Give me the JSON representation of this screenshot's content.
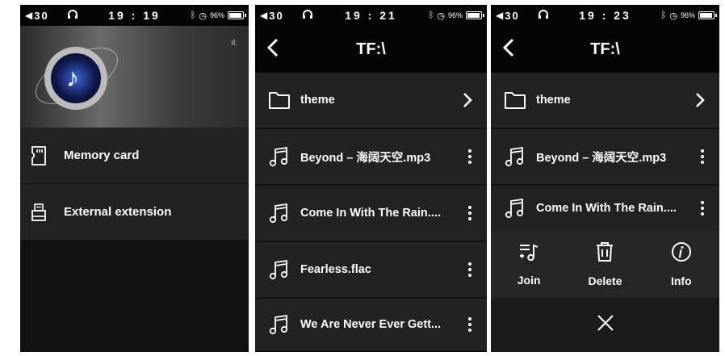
{
  "colors": {
    "panel": "#222222",
    "bar": "#050505",
    "text": "#ffffff"
  },
  "status": [
    {
      "volume": "30",
      "time": "19 : 19",
      "battery": "96%",
      "battery_level": 0.96
    },
    {
      "volume": "30",
      "time": "19 : 21",
      "battery": "96%",
      "battery_level": 0.96
    },
    {
      "volume": "30",
      "time": "19 : 23",
      "battery": "96%",
      "battery_level": 0.96
    }
  ],
  "home": {
    "items": [
      {
        "label": "Memory card",
        "icon": "sd-card-icon"
      },
      {
        "label": "External extension",
        "icon": "usb-drive-icon"
      }
    ]
  },
  "browser": {
    "title": "TF:\\",
    "items": [
      {
        "label": "theme",
        "icon": "folder-icon",
        "trail": "chevron-right-icon"
      },
      {
        "label": "Beyond – 海阔天空.mp3",
        "icon": "music-note-icon",
        "trail": "more-vertical-icon"
      },
      {
        "label": "Come In With The Rain....",
        "icon": "music-note-icon",
        "trail": "more-vertical-icon"
      },
      {
        "label": "Fearless.flac",
        "icon": "music-note-icon",
        "trail": "more-vertical-icon"
      },
      {
        "label": "We Are Never Ever Gett...",
        "icon": "music-note-icon",
        "trail": "more-vertical-icon"
      }
    ]
  },
  "actions": [
    {
      "label": "Join",
      "icon": "add-to-playlist-icon"
    },
    {
      "label": "Delete",
      "icon": "trash-icon"
    },
    {
      "label": "Info",
      "icon": "info-icon"
    }
  ]
}
